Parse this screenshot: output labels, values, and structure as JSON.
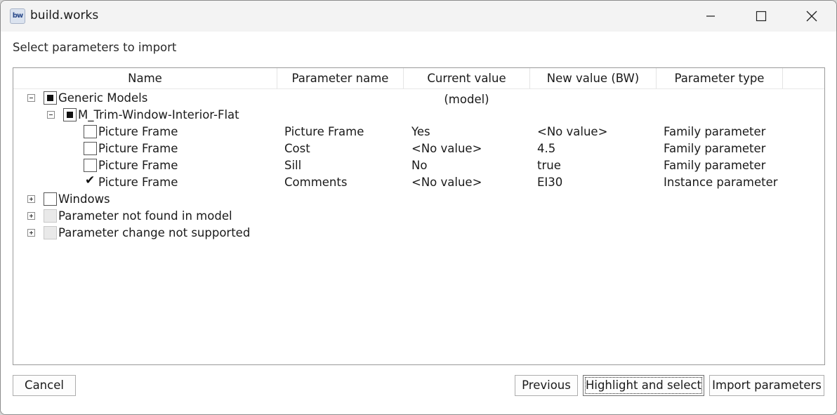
{
  "window": {
    "title": "build.works",
    "icon_text": "bw"
  },
  "prompt": "Select parameters to import",
  "columns": [
    "Name",
    "Parameter name",
    "Current value (model)",
    "New value (BW)",
    "Parameter type"
  ],
  "tree": {
    "generic_models": {
      "label": "Generic Models",
      "expanded": true,
      "check": "partial"
    },
    "family": {
      "label": "M_Trim-Window-Interior-Flat",
      "expanded": true,
      "check": "partial"
    },
    "rows": [
      {
        "name": "Picture Frame",
        "param": "Picture Frame",
        "current": "Yes",
        "new": "<No value>",
        "type": "Family parameter",
        "checked": false
      },
      {
        "name": "Picture Frame",
        "param": "Cost",
        "current": "<No value>",
        "new": "4.5",
        "type": "Family parameter",
        "checked": false
      },
      {
        "name": "Picture Frame",
        "param": "Sill",
        "current": "No",
        "new": "true",
        "type": "Family parameter",
        "checked": false
      },
      {
        "name": "Picture Frame",
        "param": "Comments",
        "current": "<No value>",
        "new": "EI30",
        "type": "Instance parameter",
        "checked": true
      }
    ],
    "windows": {
      "label": "Windows",
      "expanded": false
    },
    "not_found": {
      "label": "Parameter not found in model",
      "expanded": false
    },
    "not_supported": {
      "label": "Parameter change not supported",
      "expanded": false
    }
  },
  "buttons": {
    "cancel": "Cancel",
    "previous": "Previous",
    "highlight": "Highlight and select",
    "import": "Import parameters"
  },
  "icons": {
    "minimize": "minimize-icon",
    "maximize": "maximize-icon",
    "close": "close-icon",
    "collapse": "minus-box-icon",
    "expand": "plus-box-icon"
  }
}
